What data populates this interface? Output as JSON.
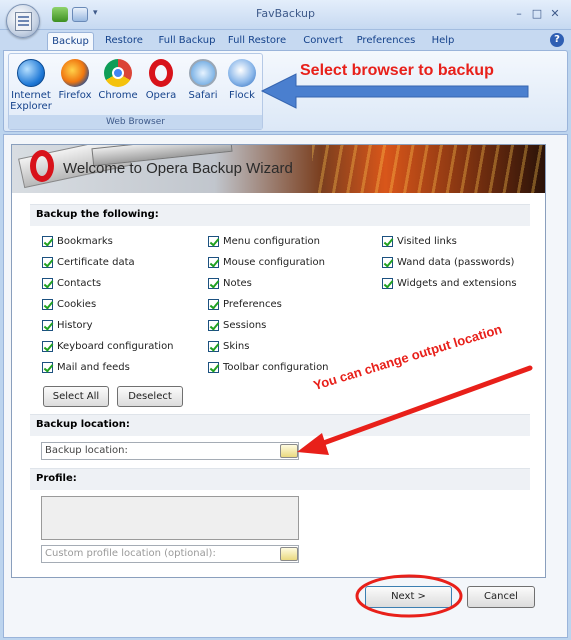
{
  "window": {
    "title": "FavBackup"
  },
  "tabs": [
    "Backup",
    "Restore",
    "Full Backup",
    "Full Restore",
    "Convert",
    "Preferences",
    "Help"
  ],
  "ribbon": {
    "group_label": "Web Browser",
    "browsers": [
      {
        "label_line1": "Internet",
        "label_line2": "Explorer",
        "icon": "internet-explorer-icon"
      },
      {
        "label_line1": "Firefox",
        "label_line2": "",
        "icon": "firefox-icon"
      },
      {
        "label_line1": "Chrome",
        "label_line2": "",
        "icon": "chrome-icon"
      },
      {
        "label_line1": "Opera",
        "label_line2": "",
        "icon": "opera-icon"
      },
      {
        "label_line1": "Safari",
        "label_line2": "",
        "icon": "safari-icon"
      },
      {
        "label_line1": "Flock",
        "label_line2": "",
        "icon": "flock-icon"
      }
    ]
  },
  "annotations": {
    "select_browser": "Select browser to backup",
    "change_output": "You can change output location"
  },
  "wizard": {
    "title": "Welcome to Opera Backup Wizard",
    "backup_heading": "Backup the following:",
    "items_col1": [
      "Bookmarks",
      "Certificate data",
      "Contacts",
      "Cookies",
      "History",
      "Keyboard configuration",
      "Mail and feeds"
    ],
    "items_col2": [
      "Menu configuration",
      "Mouse configuration",
      "Notes",
      "Preferences",
      "Sessions",
      "Skins",
      "Toolbar configuration"
    ],
    "items_col3": [
      "Visited links",
      "Wand data (passwords)",
      "Widgets and extensions"
    ],
    "select_all": "Select All",
    "deselect": "Deselect",
    "location_heading": "Backup location:",
    "location_placeholder": "Backup location:",
    "profile_heading": "Profile:",
    "profile_placeholder": "Custom profile location (optional):",
    "next": "Next >",
    "cancel": "Cancel"
  },
  "colors": {
    "annotation": "#e8201a",
    "arrow": "#4a7fcf",
    "ribbon": "#c6d9f1"
  }
}
